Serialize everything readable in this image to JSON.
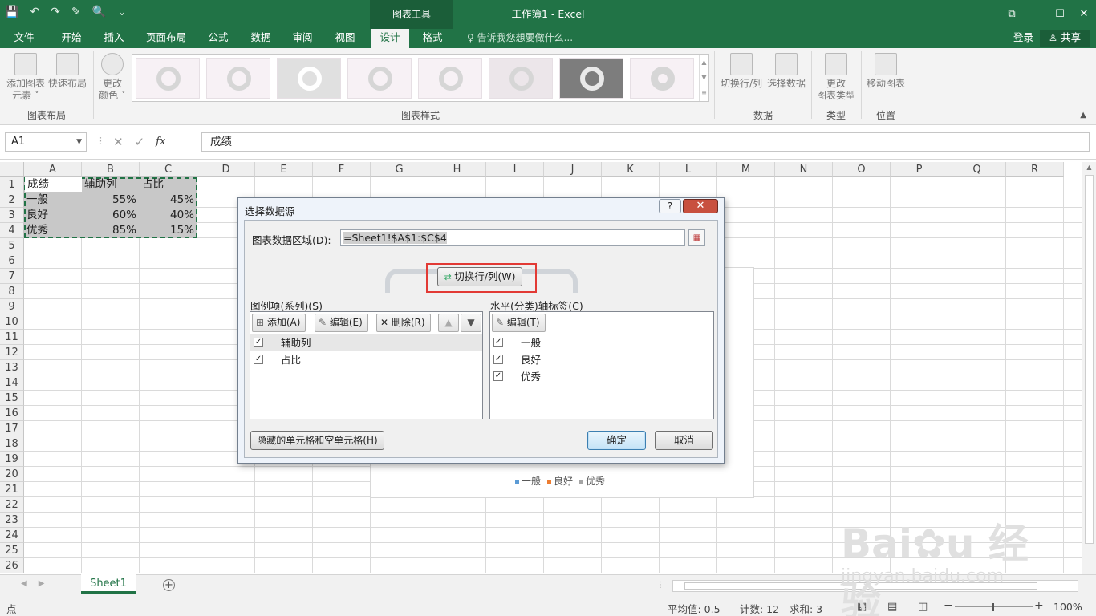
{
  "titlebar": {
    "context_tab": "图表工具",
    "doc_title": "工作簿1 - Excel",
    "qat": [
      "💾",
      "↶",
      "↷",
      "✎",
      "🔍",
      "⌄"
    ],
    "winctl": [
      "⧉",
      "—",
      "☐",
      "✕"
    ]
  },
  "tabs": {
    "file": "文件",
    "items": [
      "开始",
      "插入",
      "页面布局",
      "公式",
      "数据",
      "审阅",
      "视图",
      "设计",
      "格式"
    ],
    "active": "设计",
    "tellme": "♀ 告诉我您想要做什么...",
    "login": "登录",
    "share": "♙ 共享"
  },
  "ribbon": {
    "add_element": "添加图表\n元素 ˅",
    "quick_layout": "快速布局",
    "change_colors": "更改\n颜色 ˅",
    "group_layout": "图表布局",
    "group_styles": "图表样式",
    "switch_rowcol": "切换行/列",
    "select_data": "选择数据",
    "group_data": "数据",
    "change_type": "更改\n图表类型",
    "group_type": "类型",
    "move_chart": "移动图表",
    "group_location": "位置"
  },
  "formula_bar": {
    "name_box": "A1",
    "formula": "成绩",
    "fx": "fx",
    "cancel": "✕",
    "enter": "✓"
  },
  "grid": {
    "columns": [
      "A",
      "B",
      "C",
      "D",
      "E",
      "F",
      "G",
      "H",
      "I",
      "J",
      "K",
      "L",
      "M",
      "N",
      "O",
      "P",
      "Q",
      "R"
    ],
    "rows": [
      "1",
      "2",
      "3",
      "4",
      "5",
      "6",
      "7",
      "8",
      "9",
      "10",
      "11",
      "12",
      "13",
      "14",
      "15",
      "16",
      "17",
      "18",
      "19",
      "20",
      "21",
      "22",
      "23",
      "24",
      "25",
      "26"
    ],
    "cells": [
      [
        "成绩",
        "辅助列",
        "占比"
      ],
      [
        "一般",
        "55%",
        "45%"
      ],
      [
        "良好",
        "60%",
        "40%"
      ],
      [
        "优秀",
        "85%",
        "15%"
      ]
    ]
  },
  "chart": {
    "legend": [
      {
        "name": "一般",
        "color": "#5b9bd5"
      },
      {
        "name": "良好",
        "color": "#ed7d31"
      },
      {
        "name": "优秀",
        "color": "#a5a5a5"
      }
    ]
  },
  "dialog": {
    "title": "选择数据源",
    "help": "?",
    "close": "✕",
    "range_label": "图表数据区域(D):",
    "range_value": "=Sheet1!$A$1:$C$4",
    "switch_button": "切换行/列(W)",
    "legend_label": "图例项(系列)(S)",
    "axis_label": "水平(分类)轴标签(C)",
    "add_button": "添加(A)",
    "edit_button": "编辑(E)",
    "delete_button": "删除(R)",
    "axis_edit_button": "编辑(T)",
    "series": [
      "辅助列",
      "占比"
    ],
    "categories": [
      "一般",
      "良好",
      "优秀"
    ],
    "hidden_cells_button": "隐藏的单元格和空单元格(H)",
    "ok": "确定",
    "cancel": "取消"
  },
  "sheets": {
    "tab": "Sheet1",
    "add": "+"
  },
  "status": {
    "mode": "点",
    "average": "平均值: 0.5",
    "count": "计数: 12",
    "sum": "求和: 3",
    "zoom": "100%"
  },
  "watermark": {
    "brand": "Bai✿u 经验",
    "url": "jingyan.baidu.com"
  }
}
